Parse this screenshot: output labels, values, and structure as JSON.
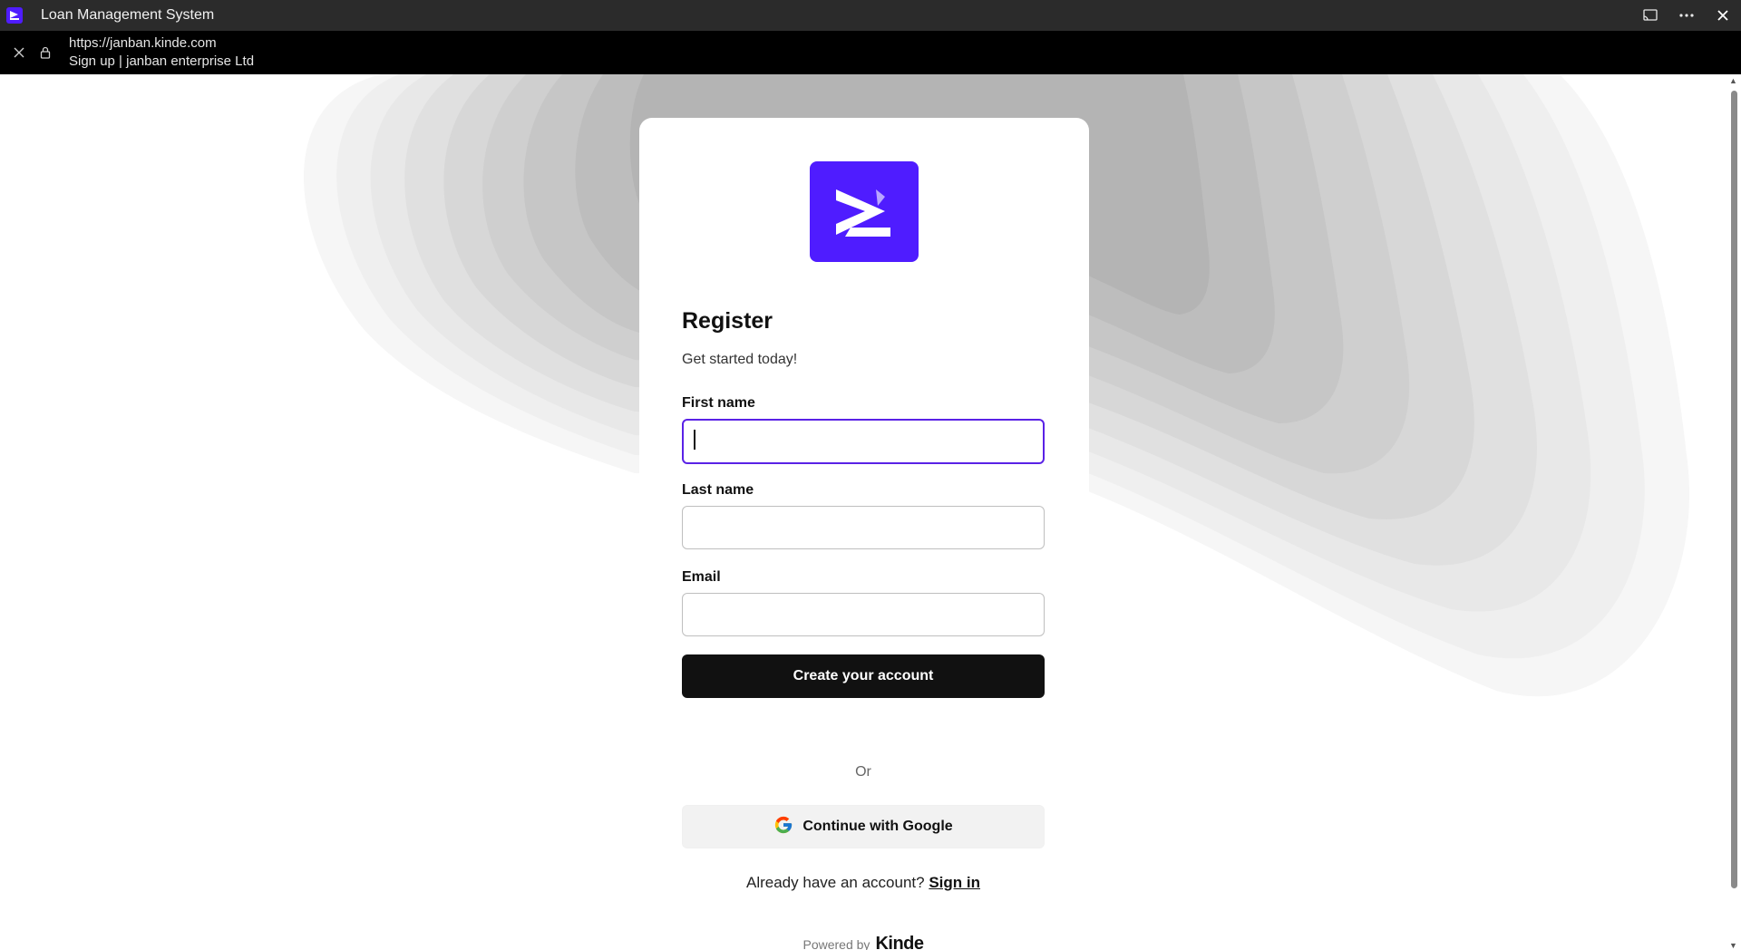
{
  "window": {
    "title": "Loan Management System",
    "controls": [
      "cast-icon",
      "more-icon",
      "close-icon"
    ]
  },
  "address_bar": {
    "url": "https://janban.kinde.com",
    "page_title": "Sign up | janban enterprise Ltd"
  },
  "form": {
    "heading": "Register",
    "subheading": "Get started today!",
    "first_name_label": "First name",
    "first_name_value": "",
    "last_name_label": "Last name",
    "last_name_value": "",
    "email_label": "Email",
    "email_value": "",
    "submit_label": "Create your account",
    "divider_text": "Or",
    "google_label": "Continue with Google",
    "signin_prompt": "Already have an account?",
    "signin_link": "Sign in"
  },
  "footer": {
    "powered_label": "Powered by",
    "brand": "Kinde"
  },
  "colors": {
    "brand": "#4f1cff",
    "focus": "#5a22e6",
    "primary_button": "#111111"
  }
}
